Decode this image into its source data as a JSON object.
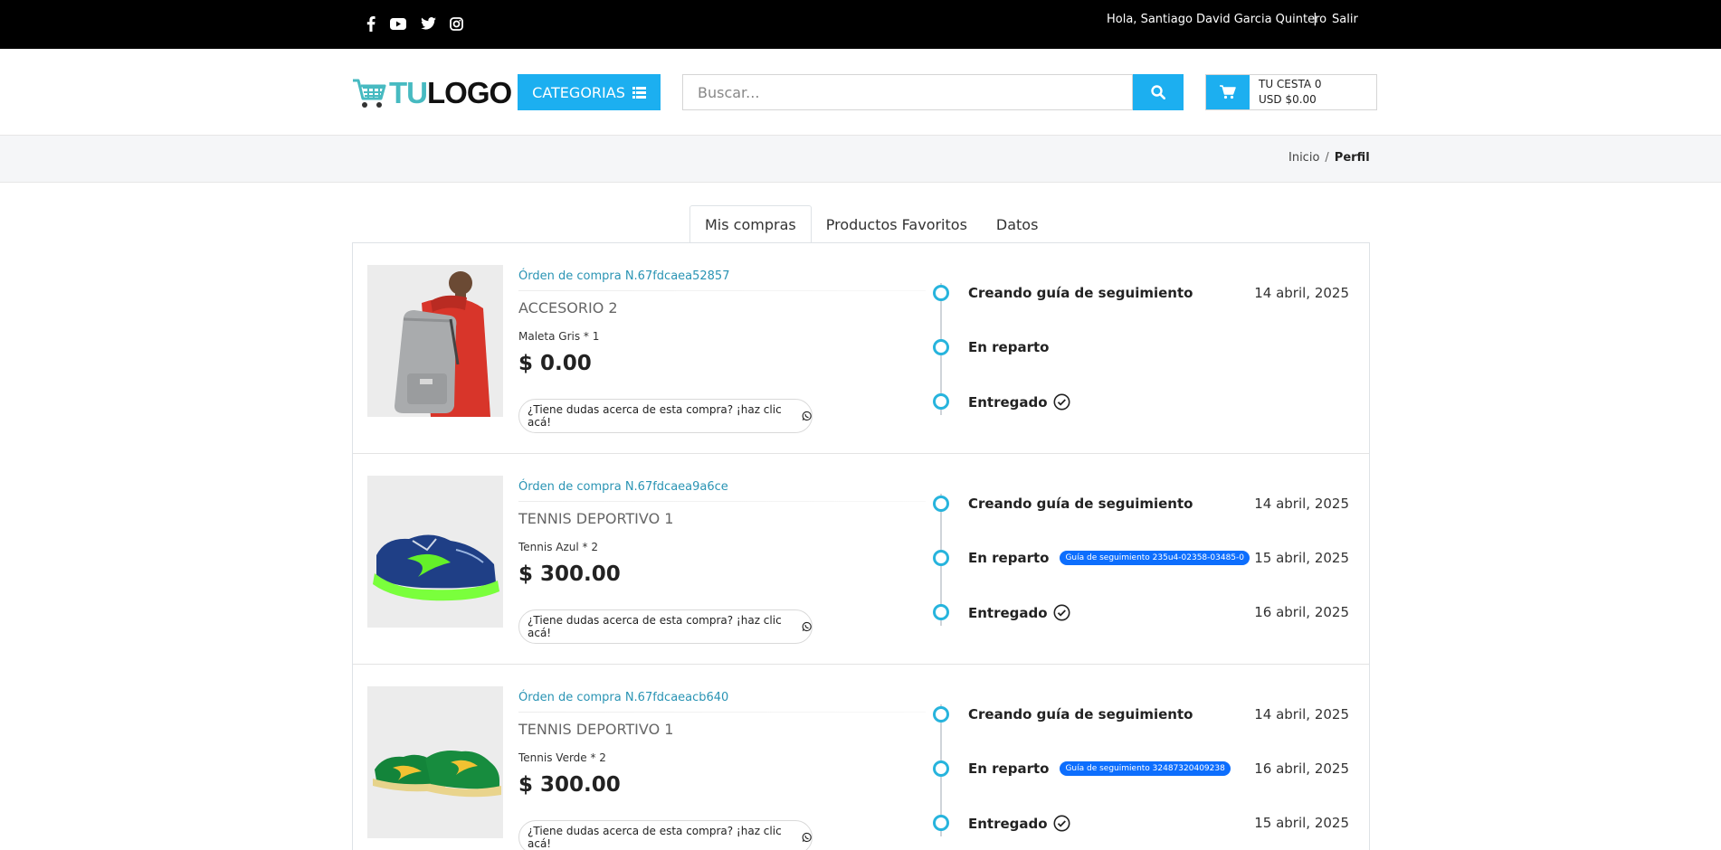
{
  "topbar": {
    "greeting": "Hola, Santiago David Garcia Quintero",
    "separator": "|",
    "logout": "Salir",
    "social_icons": [
      "facebook-icon",
      "youtube-icon",
      "twitter-icon",
      "instagram-icon"
    ]
  },
  "header": {
    "logo_tu": "TU",
    "logo_logo": "LOGO",
    "categories_label": "CATEGORIAS",
    "search_placeholder": "Buscar...",
    "cart_line1": "TU CESTA 0",
    "cart_line2": "USD $0.00"
  },
  "breadcrumb": {
    "home": "Inicio",
    "divider": "/",
    "current": "Perfil"
  },
  "tabs": [
    {
      "label": "Mis compras",
      "active": true
    },
    {
      "label": "Productos Favoritos",
      "active": false
    },
    {
      "label": "Datos",
      "active": false
    }
  ],
  "orders": [
    {
      "order_id": "Órden de compra N.67fdcaea52857",
      "product_name": "ACCESORIO 2",
      "description": "Maleta Gris * 1",
      "price": "$ 0.00",
      "help": "¿Tiene dudas acerca de esta compra? ¡haz clic acá!",
      "image": "backpack",
      "timeline": [
        {
          "label": "Creando guía de seguimiento",
          "date": "14 abril, 2025"
        },
        {
          "label": "En reparto",
          "date": ""
        },
        {
          "label": "Entregado",
          "date": ""
        }
      ]
    },
    {
      "order_id": "Órden de compra N.67fdcaea9a6ce",
      "product_name": "TENNIS DEPORTIVO 1",
      "description": "Tennis Azul * 2",
      "price": "$ 300.00",
      "help": "¿Tiene dudas acerca de esta compra? ¡haz clic acá!",
      "image": "blue-sneaker",
      "timeline": [
        {
          "label": "Creando guía de seguimiento",
          "date": "14 abril, 2025"
        },
        {
          "label": "En reparto",
          "date": "15 abril, 2025",
          "badge": "Guía de seguimiento 235u4-02358-03485-0"
        },
        {
          "label": "Entregado",
          "date": "16 abril, 2025"
        }
      ]
    },
    {
      "order_id": "Órden de compra N.67fdcaeacb640",
      "product_name": "TENNIS DEPORTIVO 1",
      "description": "Tennis Verde * 2",
      "price": "$ 300.00",
      "help": "¿Tiene dudas acerca de esta compra? ¡haz clic acá!",
      "image": "green-sneakers",
      "timeline": [
        {
          "label": "Creando guía de seguimiento",
          "date": "14 abril, 2025"
        },
        {
          "label": "En reparto",
          "date": "16 abril, 2025",
          "badge": "Guía de seguimiento 32487320409238"
        },
        {
          "label": "Entregado",
          "date": "15 abril, 2025"
        }
      ]
    }
  ],
  "colors": {
    "accent": "#1caff0",
    "timeline": "#27b4dd",
    "link": "#2a94b4",
    "badge": "#0d6efd"
  }
}
